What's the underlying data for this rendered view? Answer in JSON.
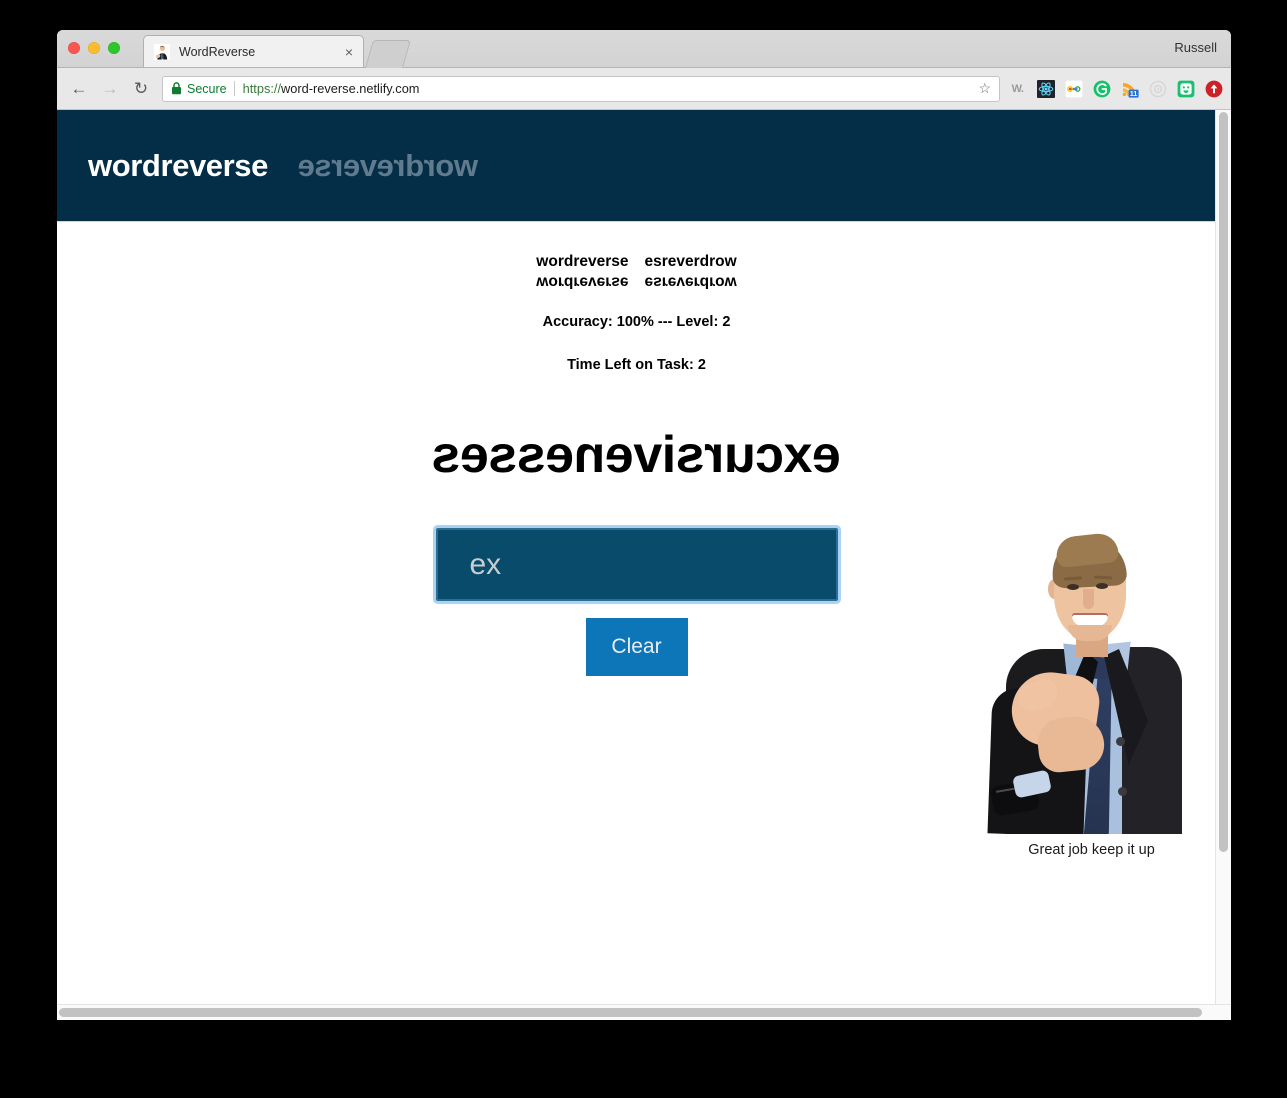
{
  "browser": {
    "profile_name": "Russell",
    "tab": {
      "title": "WordReverse",
      "close_label": "×",
      "favicon_name": "businessman-favicon"
    },
    "new_tab_label": "",
    "nav": {
      "back": "←",
      "forward": "→",
      "reload": "↻"
    },
    "omnibox": {
      "secure_label": "Secure",
      "url_scheme": "https://",
      "url_rest": "word-reverse.netlify.com",
      "full_url": "https://word-reverse.netlify.com",
      "bookmark_star": "☆"
    },
    "extensions": [
      {
        "name": "wikipedia-extension-icon",
        "label": "W."
      },
      {
        "name": "react-devtools-extension-icon",
        "label": ""
      },
      {
        "name": "link-extension-icon",
        "label": ""
      },
      {
        "name": "grammarly-extension-icon",
        "label": "G"
      },
      {
        "name": "rss-feed-extension-icon",
        "label": "",
        "badge": "11"
      },
      {
        "name": "target-extension-icon",
        "label": ""
      },
      {
        "name": "messenger-extension-icon",
        "label": ""
      },
      {
        "name": "upload-extension-icon",
        "label": ""
      }
    ]
  },
  "site": {
    "header": {
      "logo": "wordreverse",
      "logo_mirror": "wordreverse"
    },
    "word_grid": {
      "col1_top": "wordreverse",
      "col1_bottom": "wordreverse",
      "col2_top": "esreverdrow",
      "col2_bottom": "esreverdrow"
    },
    "stats": {
      "accuracy_line": "Accuracy: 100% --- Level: 2",
      "accuracy_value": "100%",
      "level_value": "2",
      "time_line": "Time Left on Task: 2",
      "time_value": "2"
    },
    "challenge": {
      "word": "excursivenesses"
    },
    "answer": {
      "value": "ex",
      "placeholder": ""
    },
    "clear_button": "Clear",
    "feedback": {
      "caption": "Great job keep it up",
      "image_name": "businessman-handshake-photo"
    }
  },
  "colors": {
    "header_navy": "#042e47",
    "input_navy": "#084b6b",
    "focus_glow": "#a9d2f5",
    "clear_blue": "#0d76b8",
    "logo_mirror_gray": "#5f7b8d",
    "secure_green": "#0f7c32"
  }
}
